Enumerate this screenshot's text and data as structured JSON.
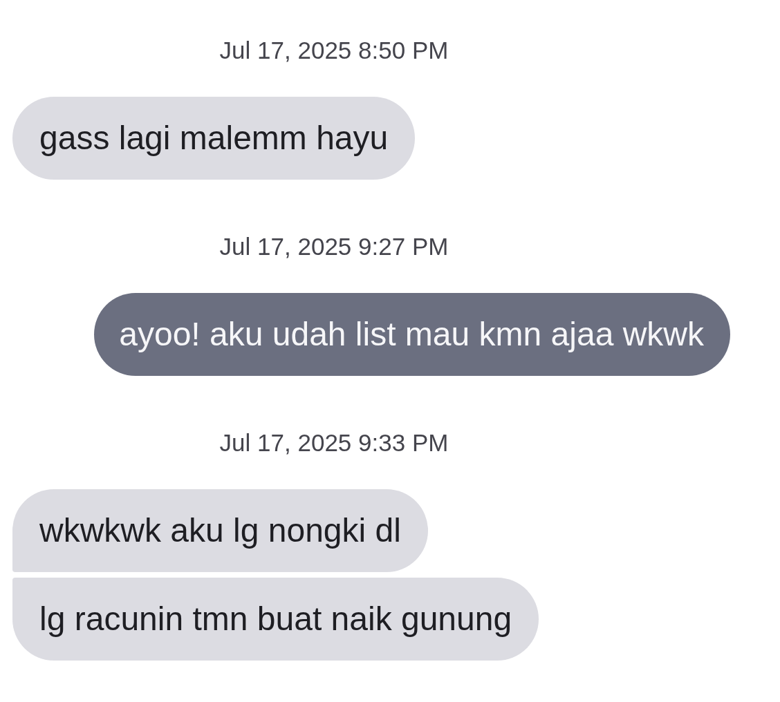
{
  "thread": [
    {
      "timestamp": "Jul 17, 2025 8:50 PM",
      "kind": "received",
      "messages": [
        "gass lagi malemm hayu"
      ]
    },
    {
      "timestamp": "Jul 17, 2025 9:27 PM",
      "kind": "sent",
      "messages": [
        "ayoo! aku udah list mau kmn ajaa wkwk"
      ]
    },
    {
      "timestamp": "Jul 17, 2025 9:33 PM",
      "kind": "received",
      "messages": [
        "wkwkwk aku lg nongki dl",
        "lg racunin tmn buat naik gunung"
      ]
    }
  ]
}
